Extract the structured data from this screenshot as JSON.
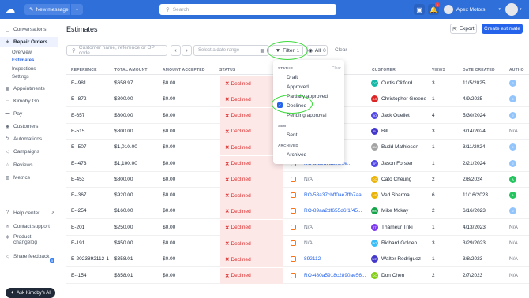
{
  "topbar": {
    "new_message_label": "New message",
    "search_placeholder": "Search",
    "notification_count": "1",
    "account_name": "Apex Motors"
  },
  "sidebar": {
    "items": [
      {
        "label": "Conversations",
        "icon": "chat-icon"
      },
      {
        "label": "Repair Orders",
        "icon": "wrench-icon",
        "active": true
      },
      {
        "label": "Appointments",
        "icon": "calendar-icon"
      },
      {
        "label": "Kimoby Go",
        "icon": "car-icon"
      },
      {
        "label": "Pay",
        "icon": "card-icon"
      },
      {
        "label": "Customers",
        "icon": "user-icon"
      },
      {
        "label": "Automations",
        "icon": "bolt-icon"
      },
      {
        "label": "Campaigns",
        "icon": "megaphone-icon"
      },
      {
        "label": "Reviews",
        "icon": "star-icon"
      },
      {
        "label": "Metrics",
        "icon": "chart-icon"
      }
    ],
    "subitems": [
      {
        "label": "Overview"
      },
      {
        "label": "Estimates",
        "active": true
      },
      {
        "label": "Inspections"
      },
      {
        "label": "Settings"
      }
    ],
    "bottom": [
      {
        "label": "Help center"
      },
      {
        "label": "Contact support"
      },
      {
        "label": "Product changelog"
      },
      {
        "label": "Share feedback"
      }
    ],
    "changelog_badge": "5",
    "ask_label": "Ask Kimoby's AI"
  },
  "page": {
    "title": "Estimates",
    "export_label": "Export",
    "create_label": "Create estimate"
  },
  "filters": {
    "search_placeholder": "Customer name, reference or OP code",
    "date_placeholder": "Select a date range",
    "filter_label": "Filter",
    "filter_count": "1",
    "all_label": "All",
    "all_count": "0",
    "clear_label": "Clear"
  },
  "table": {
    "headers": {
      "reference": "REFERENCE",
      "total": "TOTAL AMOUNT",
      "accepted": "AMOUNT ACCEPTED",
      "status": "STATUS",
      "customer": "CUSTOMER",
      "views": "VIEWS",
      "date": "DATE CREATED",
      "author": "AUTHO"
    },
    "rows": [
      {
        "ref": "E--981",
        "total": "$658.97",
        "accepted": "$0.00",
        "status": "Declined",
        "ro": "",
        "customer": "Curtis Clifford",
        "initials": "CC",
        "color": "#14b8a6",
        "views": "3",
        "date": "11/5/2025",
        "author": "J"
      },
      {
        "ref": "E--872",
        "total": "$800.00",
        "accepted": "$0.00",
        "status": "Declined",
        "ro": "...bb982...",
        "customer": "Christopher Greene",
        "initials": "CG",
        "color": "#dc2626",
        "views": "1",
        "date": "4/9/2025",
        "author": "J"
      },
      {
        "ref": "E-657",
        "total": "$800.00",
        "accepted": "$0.00",
        "status": "Declined",
        "ro": "",
        "customer": "Jack Ouellet",
        "initials": "JO",
        "color": "#4f46e5",
        "views": "4",
        "date": "5/30/2024",
        "author": "J"
      },
      {
        "ref": "E-515",
        "total": "$800.00",
        "accepted": "$0.00",
        "status": "Declined",
        "ro": "",
        "customer": "Bill",
        "initials": "B",
        "color": "#4338ca",
        "views": "3",
        "date": "3/14/2024",
        "author": "N/A"
      },
      {
        "ref": "E--507",
        "total": "$1,010.00",
        "accepted": "$0.00",
        "status": "Declined",
        "ro": "...379d1...",
        "customer": "Budd Mathieson",
        "initials": "BM",
        "color": "#a3a3a3",
        "views": "1",
        "date": "3/11/2024",
        "author": "J"
      },
      {
        "ref": "E--473",
        "total": "$1,100.00",
        "accepted": "$0.00",
        "status": "Declined",
        "ro": "RO-afd9a7dd0c...e...",
        "customer": "Jason Forster",
        "initials": "JF",
        "color": "#4f46e5",
        "views": "1",
        "date": "2/21/2024",
        "author": "J"
      },
      {
        "ref": "E-453",
        "total": "$800.00",
        "accepted": "$0.00",
        "status": "Declined",
        "ro": "N/A",
        "customer": "Cato Cheung",
        "initials": "CC",
        "color": "#eab308",
        "views": "2",
        "date": "2/8/2024",
        "author": "A"
      },
      {
        "ref": "E--367",
        "total": "$920.00",
        "accepted": "$0.00",
        "status": "Declined",
        "ro": "RO-58a37cbff0ae7ffb7aa...",
        "customer": "Ved Sharma",
        "initials": "VS",
        "color": "#eab308",
        "views": "6",
        "date": "11/16/2023",
        "author": "A"
      },
      {
        "ref": "E--254",
        "total": "$160.00",
        "accepted": "$0.00",
        "status": "Declined",
        "ro": "RO-89aa2df655d6f1f45...",
        "customer": "Mike Mckay",
        "initials": "MM",
        "color": "#16a34a",
        "views": "2",
        "date": "6/16/2023",
        "author": "J"
      },
      {
        "ref": "E-201",
        "total": "$250.00",
        "accepted": "$0.00",
        "status": "Declined",
        "ro": "N/A",
        "customer": "Thameur Triki",
        "initials": "TT",
        "color": "#7c3aed",
        "views": "1",
        "date": "4/13/2023",
        "author": "N/A"
      },
      {
        "ref": "E-191",
        "total": "$450.00",
        "accepted": "$0.00",
        "status": "Declined",
        "ro": "N/A",
        "customer": "Richard Golden",
        "initials": "RG",
        "color": "#38bdf8",
        "views": "3",
        "date": "3/29/2023",
        "author": "N/A"
      },
      {
        "ref": "E-2023892112-1",
        "total": "$358.01",
        "accepted": "$0.00",
        "status": "Declined",
        "ro": "892112",
        "customer": "Walter Rodriguez",
        "initials": "WR",
        "color": "#4338ca",
        "views": "1",
        "date": "3/8/2023",
        "author": "N/A"
      },
      {
        "ref": "E--154",
        "total": "$358.01",
        "accepted": "$0.00",
        "status": "Declined",
        "ro": "RO-480a5918c2890ae56...",
        "customer": "Don Chen",
        "initials": "DC",
        "color": "#84cc16",
        "views": "2",
        "date": "2/7/2023",
        "author": "N/A"
      }
    ]
  },
  "dropdown": {
    "status_header": "STATUS",
    "clear_label": "Clear",
    "status_options": [
      "Draft",
      "Approved",
      "Partially approved",
      "Declined",
      "Pending approval"
    ],
    "sent_header": "SENT",
    "sent_options": [
      "Sent"
    ],
    "archived_header": "ARCHIVED",
    "archived_options": [
      "Archived"
    ]
  },
  "colors": {
    "brand": "#2f6fd9",
    "primary_button": "#2563eb",
    "declined_bg": "#fde8e8",
    "declined_text": "#dc2626",
    "highlight_circle": "#3bdb3b"
  }
}
